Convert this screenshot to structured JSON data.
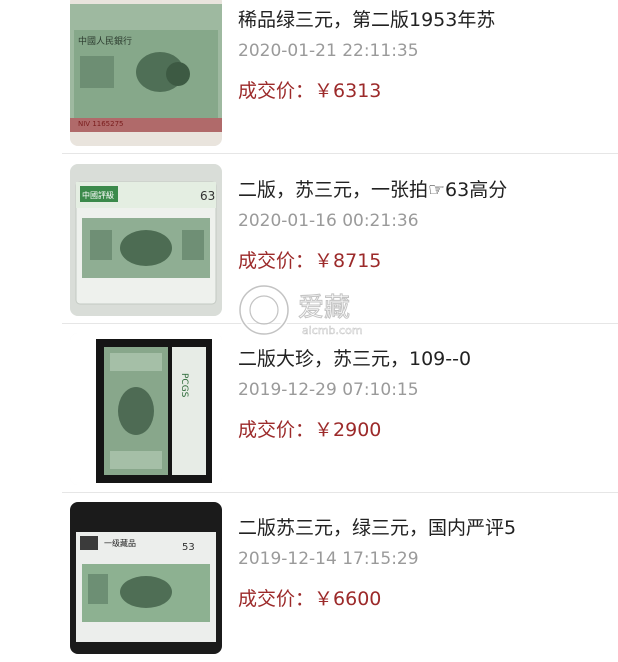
{
  "listings": [
    {
      "title": "稀品绿三元，第二版1953年苏",
      "time": "2020-01-21 22:11:35",
      "price_label": "成交价：",
      "price": "￥6313",
      "image_icon": "banknote-photo-icon"
    },
    {
      "title": "二版，苏三元，一张拍☞63高分",
      "time": "2020-01-16 00:21:36",
      "price_label": "成交价：",
      "price": "￥8715",
      "image_icon": "graded-banknote-photo-icon"
    },
    {
      "title": "二版大珍，苏三元，109--0",
      "time": "2019-12-29 07:10:15",
      "price_label": "成交价：",
      "price": "￥2900",
      "image_icon": "slabbed-banknote-photo-icon"
    },
    {
      "title": "二版苏三元，绿三元，国内严评5",
      "time": "2019-12-14 17:15:29",
      "price_label": "成交价：",
      "price": "￥6600",
      "image_icon": "graded-banknote-photo-icon"
    }
  ],
  "colors": {
    "price": "#9c2a2a",
    "time": "#9a9a9a",
    "title": "#222222",
    "separator": "#e6e6e6"
  },
  "watermark": {
    "text": "爱藏",
    "url_text": "aicmb.com"
  }
}
